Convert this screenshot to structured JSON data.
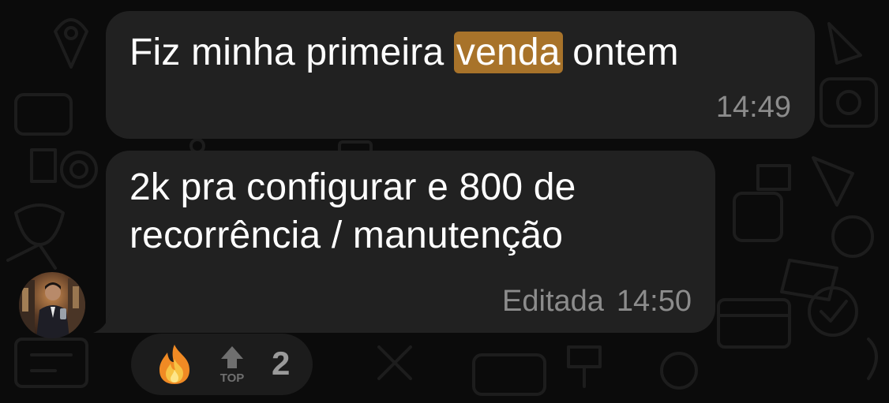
{
  "messages": [
    {
      "text_before": "Fiz minha primeira ",
      "highlight": "venda",
      "text_after": " ontem",
      "time": "14:49"
    },
    {
      "line1": "2k pra configurar e 800 de",
      "line2": "recorrência / manutenção",
      "edited_label": "Editada",
      "time": "14:50"
    }
  ],
  "reactions": {
    "icons": [
      "fire-icon",
      "top-arrow-icon"
    ],
    "top_label": "TOP",
    "count": "2"
  },
  "colors": {
    "background": "#0b0b0b",
    "bubble": "#212121",
    "highlight": "#a8732a",
    "meta_text": "#8c8c8c"
  }
}
